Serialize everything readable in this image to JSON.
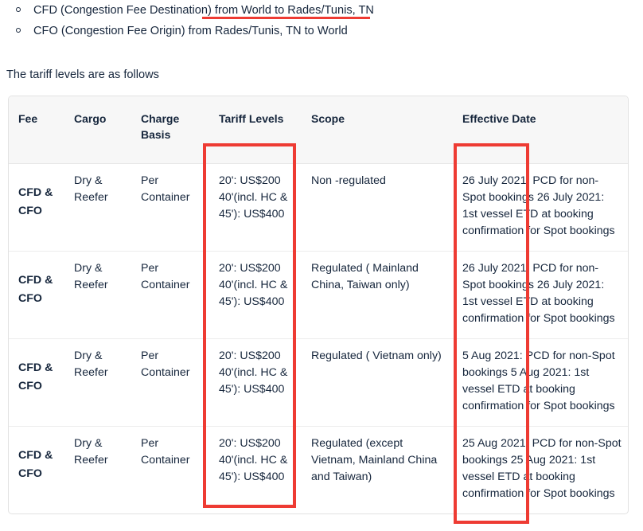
{
  "bullets": [
    {
      "lead": "CFD (Congestion Fee Destination) ",
      "tail": "from World to Rades/Tunis, TN",
      "annotated": true
    },
    {
      "lead": "CFO (Congestion Fee Origin) from Rades/Tunis, TN to World",
      "tail": "",
      "annotated": false
    }
  ],
  "intro_paragraph": "The tariff levels are as follows",
  "table": {
    "headers": [
      "Fee",
      "Cargo",
      "Charge Basis",
      "Tariff Levels",
      "Scope",
      "Effective Date"
    ],
    "rows": [
      {
        "fee": "CFD & CFO",
        "cargo": "Dry & Reefer",
        "charge_basis": "Per Container",
        "tariff_levels": "20': US$200 40'(incl. HC & 45'): US$400",
        "scope": "Non -regulated",
        "effective_date": "26 July 2021: PCD for non-Spot bookings 26 July 2021: 1st vessel ETD at booking confirmation for Spot bookings"
      },
      {
        "fee": "CFD & CFO",
        "cargo": "Dry & Reefer",
        "charge_basis": "Per Container",
        "tariff_levels": "20': US$200 40'(incl. HC & 45'): US$400",
        "scope": "Regulated ( Mainland China, Taiwan only)",
        "effective_date": "26 July 2021: PCD for non-Spot bookings 26 July 2021: 1st vessel ETD at booking confirmation for Spot bookings"
      },
      {
        "fee": "CFD & CFO",
        "cargo": "Dry & Reefer",
        "charge_basis": "Per Container",
        "tariff_levels": "20': US$200 40'(incl. HC & 45'): US$400",
        "scope": "Regulated ( Vietnam only)",
        "effective_date": "5 Aug 2021: PCD for non-Spot bookings 5 Aug 2021: 1st vessel ETD at booking confirmation for Spot bookings"
      },
      {
        "fee": "CFD & CFO",
        "cargo": "Dry & Reefer",
        "charge_basis": "Per Container",
        "tariff_levels": "20': US$200 40'(incl. HC & 45'): US$400",
        "scope": "Regulated (except Vietnam, Mainland China and Taiwan)",
        "effective_date": "25 Aug 2021: PCD for non-Spot bookings 25 Aug 2021: 1st vessel ETD at booking confirmation for Spot bookings"
      }
    ]
  },
  "annotations": {
    "color": "#ee3b33",
    "underline_target": "from World to Rades/Tunis, TN",
    "box_tariff_target": "Tariff Levels column",
    "box_date_target": "Effective Date column"
  }
}
